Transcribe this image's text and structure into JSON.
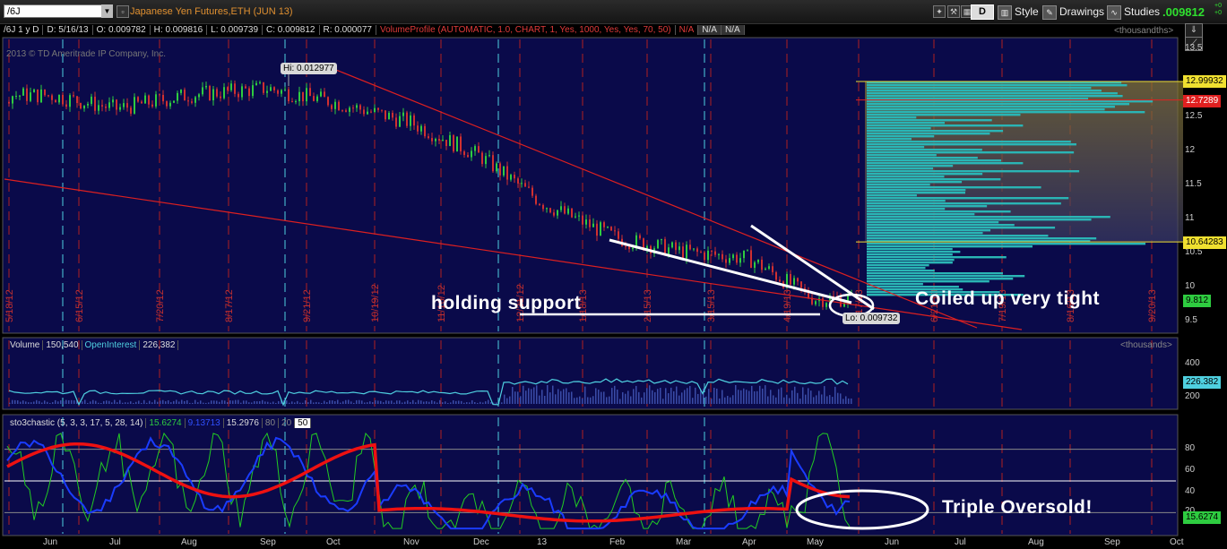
{
  "toolbar": {
    "symbol": "/6J",
    "title": "Japanese Yen Futures,ETH (JUN 13)",
    "d_button": "D",
    "style_label": "Style",
    "drawings_label": "Drawings",
    "studies_label": "Studies",
    "last_price": ".009812",
    "last_change_1": "+0",
    "last_change_2": "+0"
  },
  "info": {
    "symbol_period": "/6J 1 y D",
    "date": "D: 5/16/13",
    "open": "O: 0.009782",
    "high": "H: 0.009816",
    "low": "L: 0.009739",
    "close": "C: 0.009812",
    "range": "R: 0.000077",
    "volume_profile": "VolumeProfile (AUTOMATIC, 1.0, CHART, 1, Yes, 1000, Yes, Yes, 70, 50)",
    "na1": "N/A",
    "na2": "N/A",
    "na3": "N/A",
    "units": "<thousandths>",
    "copyright": "2013 © TD Ameritrade IP Company, Inc."
  },
  "price_axis": {
    "ticks": [
      "13.5",
      "13",
      "12.5",
      "12",
      "11.5",
      "11",
      "10.5",
      "10",
      "9.5"
    ],
    "tag_high": "12.99932",
    "tag_poc": "12.7289",
    "tag_low": "10.64283",
    "tag_last": "9.812"
  },
  "callouts": {
    "hi": "Hi: 0.012977",
    "lo": "Lo: 0.009732"
  },
  "annotations": {
    "holding": "holding support",
    "coiled": "Coiled up very tight",
    "triple": "Triple Oversold!"
  },
  "date_markers": [
    "5/18/12",
    "6/15/12",
    "7/20/12",
    "8/17/12",
    "9/21/12",
    "10/19/12",
    "11/16/12",
    "12/21/12",
    "1/18/13",
    "2/15/13",
    "3/15/13",
    "4/19/13",
    "5/17/13",
    "6/21/13",
    "7/19/13",
    "8/16/13",
    "9/20/13"
  ],
  "volume_panel": {
    "label": "Volume",
    "volume": "150,540",
    "oi_label": "OpenInterest",
    "oi": "226,382",
    "units": "<thousands>",
    "axis_top": "400",
    "axis_mid": "200",
    "tag": "226.382"
  },
  "stoch_panel": {
    "label": "sto3chastic (5, 3, 3, 17, 5, 28, 14)",
    "v1": "15.6274",
    "v2": "9.13713",
    "v3": "15.2976",
    "l80": "80",
    "l20": "20",
    "l50": "50",
    "axis": [
      "80",
      "60",
      "40",
      "20"
    ],
    "tag": "15.6274"
  },
  "x_axis": [
    "Jun",
    "Jul",
    "Aug",
    "Sep",
    "Oct",
    "Nov",
    "Dec",
    "13",
    "Feb",
    "Mar",
    "Apr",
    "May",
    "Jun",
    "Jul",
    "Aug",
    "Sep",
    "Oct"
  ],
  "colors": {
    "background": "#0a0a4a",
    "candle_up": "#2ecc40",
    "candle_down": "#d03030",
    "trendline": "#dd2020",
    "volume_profile": "#2ab5b5",
    "oi_line": "#4fd0e0",
    "stoch_green": "#22cc22",
    "stoch_blue": "#1a3cff",
    "stoch_red": "#ee1111"
  },
  "chart_data": {
    "type": "candlestick",
    "units": "thousandths",
    "ylim": [
      9.5,
      13.5
    ],
    "close_path": [
      {
        "x": "Jun",
        "y": 12.8
      },
      {
        "x": "Jul",
        "y": 12.6
      },
      {
        "x": "Aug",
        "y": 12.8
      },
      {
        "x": "Sep",
        "y": 12.9
      },
      {
        "x": "Oct",
        "y": 12.7
      },
      {
        "x": "Nov",
        "y": 12.4
      },
      {
        "x": "Dec",
        "y": 11.9
      },
      {
        "x": "13",
        "y": 11.2
      },
      {
        "x": "Feb",
        "y": 10.7
      },
      {
        "x": "Mar",
        "y": 10.5
      },
      {
        "x": "Apr",
        "y": 10.4
      },
      {
        "x": "May",
        "y": 9.81
      }
    ],
    "high": 12.977,
    "low": 9.732,
    "last": 9.812
  }
}
